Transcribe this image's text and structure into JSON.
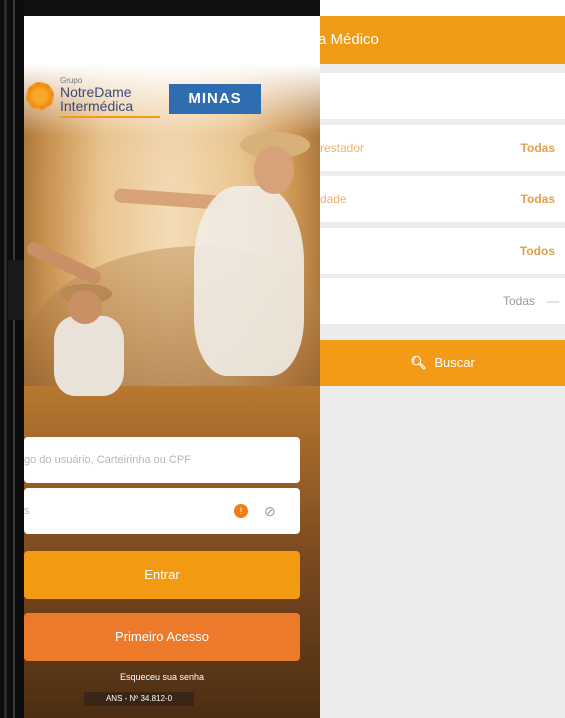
{
  "login": {
    "brand_group": "Grupo",
    "brand_line1": "NotreDame",
    "brand_line2": "Intermédica",
    "brand_region": "MINAS",
    "user_placeholder": "go do usuário, Carteirinha ou CPF",
    "password_placeholder": "s",
    "password_badge": "!",
    "enter_label": "Entrar",
    "first_access_label": "Primeiro Acesso",
    "forgot_password": "Esqueceu sua senha",
    "ans_label": "ANS - Nº 34.812-0"
  },
  "search": {
    "header_title": "a Médico",
    "search_field_placeholder": "",
    "filters": [
      {
        "label": "restador",
        "value": "Todas"
      },
      {
        "label": "dade",
        "value": "Todas"
      },
      {
        "label": "",
        "value": "Todos"
      },
      {
        "label": "",
        "value": "Todas"
      }
    ],
    "last_filter_suffix": "—",
    "search_button": "Buscar"
  },
  "colors": {
    "primary_orange": "#f39a13",
    "secondary_orange": "#ec7a2a",
    "minas_blue": "#2e6db0"
  }
}
